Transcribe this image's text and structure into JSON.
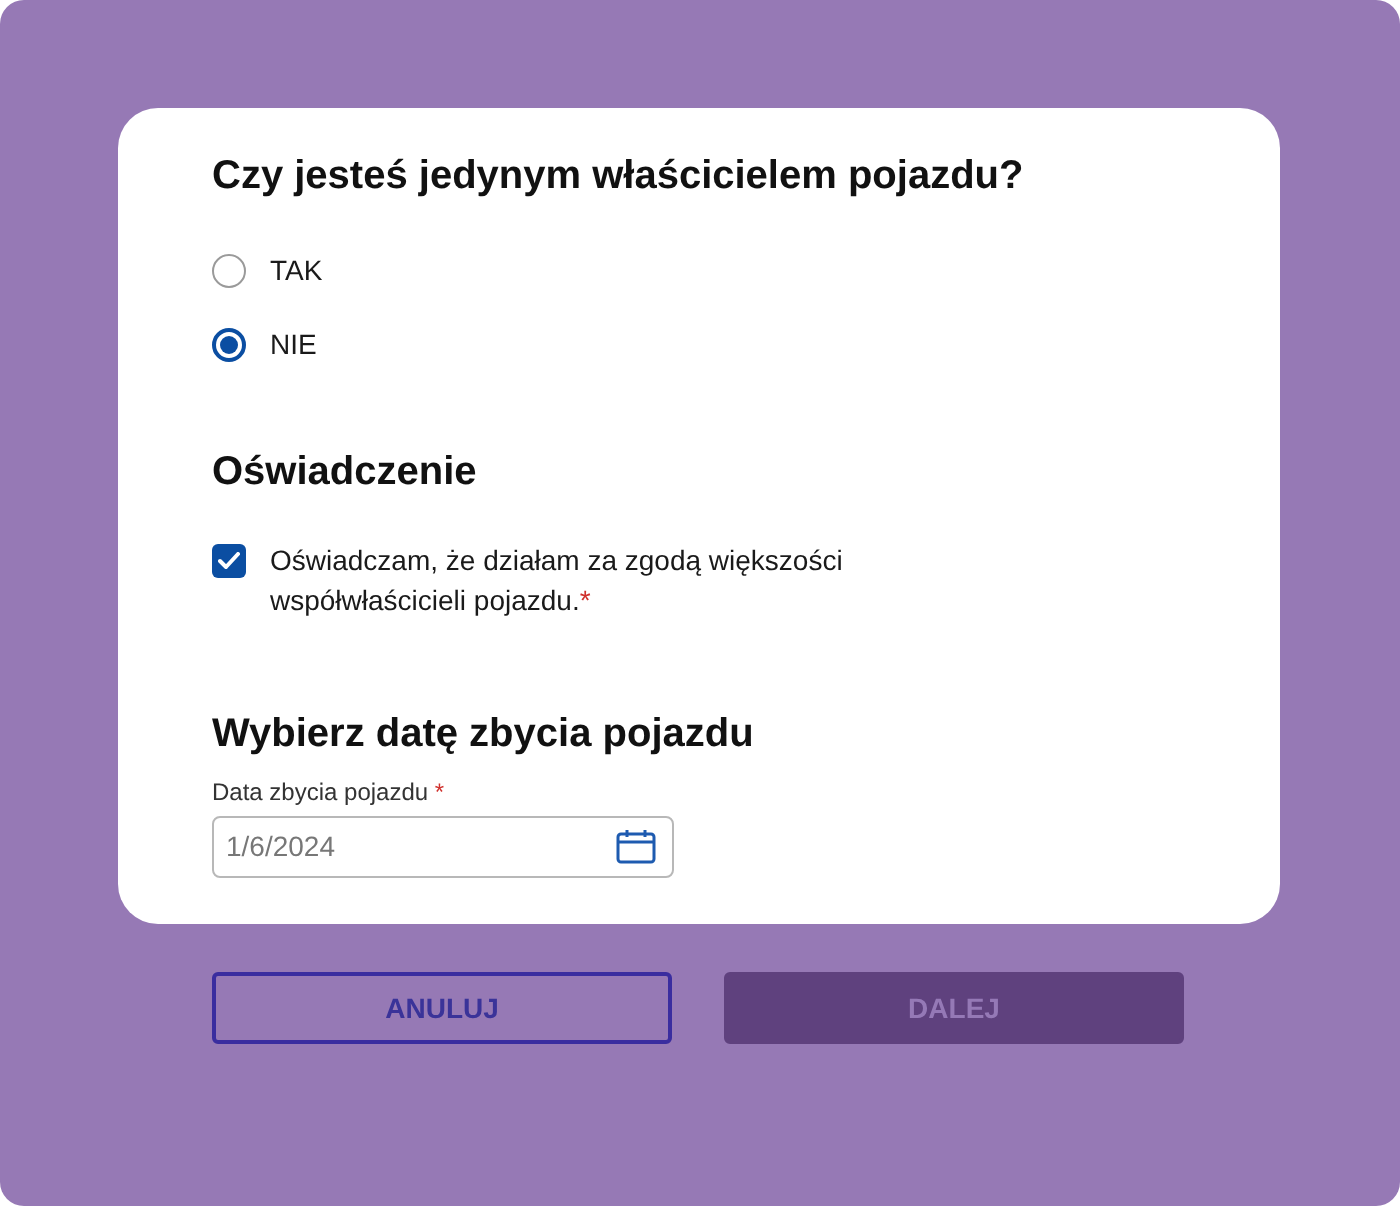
{
  "question": {
    "title": "Czy jesteś jedynym właścicielem pojazdu?",
    "options": [
      {
        "label": "TAK",
        "selected": false
      },
      {
        "label": "NIE",
        "selected": true
      }
    ]
  },
  "declaration": {
    "title": "Oświadczenie",
    "checkbox": {
      "label": "Oświadczam, że działam za zgodą większości współwłaścicieli pojazdu.",
      "required_mark": "*",
      "checked": true
    }
  },
  "date": {
    "title": "Wybierz datę zbycia pojazdu",
    "field": {
      "label": "Data zbycia pojazdu",
      "required_mark": "*",
      "value": "1/6/2024"
    }
  },
  "buttons": [
    {
      "label": "ANULUJ",
      "kind": "outline"
    },
    {
      "label": "DALEJ",
      "kind": "filled"
    }
  ]
}
